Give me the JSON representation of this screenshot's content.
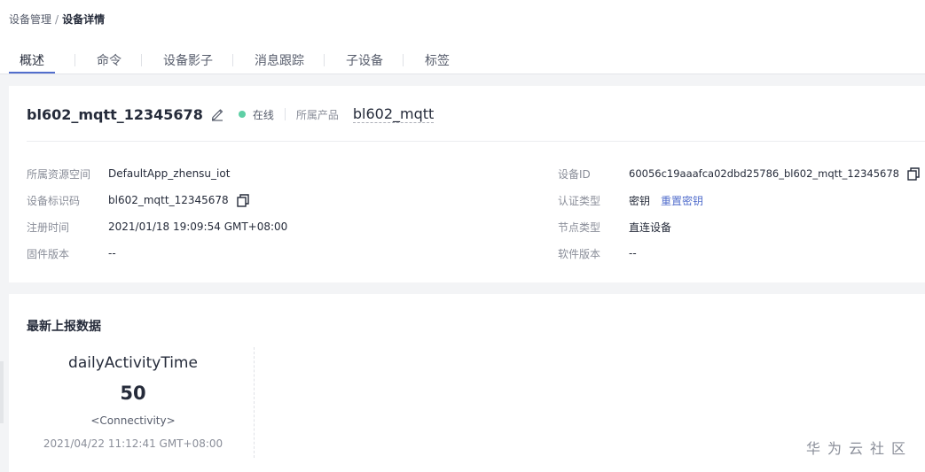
{
  "breadcrumb": {
    "parent": "设备管理",
    "separator": "/",
    "current": "设备详情"
  },
  "tabs": [
    {
      "label": "概述",
      "active": true
    },
    {
      "label": "命令",
      "active": false
    },
    {
      "label": "设备影子",
      "active": false
    },
    {
      "label": "消息跟踪",
      "active": false
    },
    {
      "label": "子设备",
      "active": false
    },
    {
      "label": "标签",
      "active": false
    }
  ],
  "device": {
    "name": "bl602_mqtt_12345678",
    "status": "在线",
    "product_label": "所属产品",
    "product_name": "bl602_mqtt",
    "status_color": "#5ecfa5"
  },
  "fields": {
    "resource_space": {
      "label": "所属资源空间",
      "value": "DefaultApp_zhensu_iot"
    },
    "node_id": {
      "label": "设备标识码",
      "value": "bl602_mqtt_12345678"
    },
    "register_time": {
      "label": "注册时间",
      "value": "2021/01/18 19:09:54 GMT+08:00"
    },
    "firmware": {
      "label": "固件版本",
      "value": "--"
    },
    "device_id": {
      "label": "设备ID",
      "value": "60056c19aaafca02dbd25786_bl602_mqtt_12345678"
    },
    "auth_type": {
      "label": "认证类型",
      "value": "密钥",
      "action": "重置密钥"
    },
    "node_type": {
      "label": "节点类型",
      "value": "直连设备"
    },
    "software": {
      "label": "软件版本",
      "value": "--"
    }
  },
  "latest_data": {
    "title": "最新上报数据",
    "metric": {
      "name": "dailyActivityTime",
      "value": "50",
      "service": "<Connectivity>",
      "time": "2021/04/22 11:12:41 GMT+08:00"
    }
  },
  "watermark": "华为云社区",
  "colors": {
    "accent": "#526ecc",
    "online": "#5ecfa5"
  }
}
